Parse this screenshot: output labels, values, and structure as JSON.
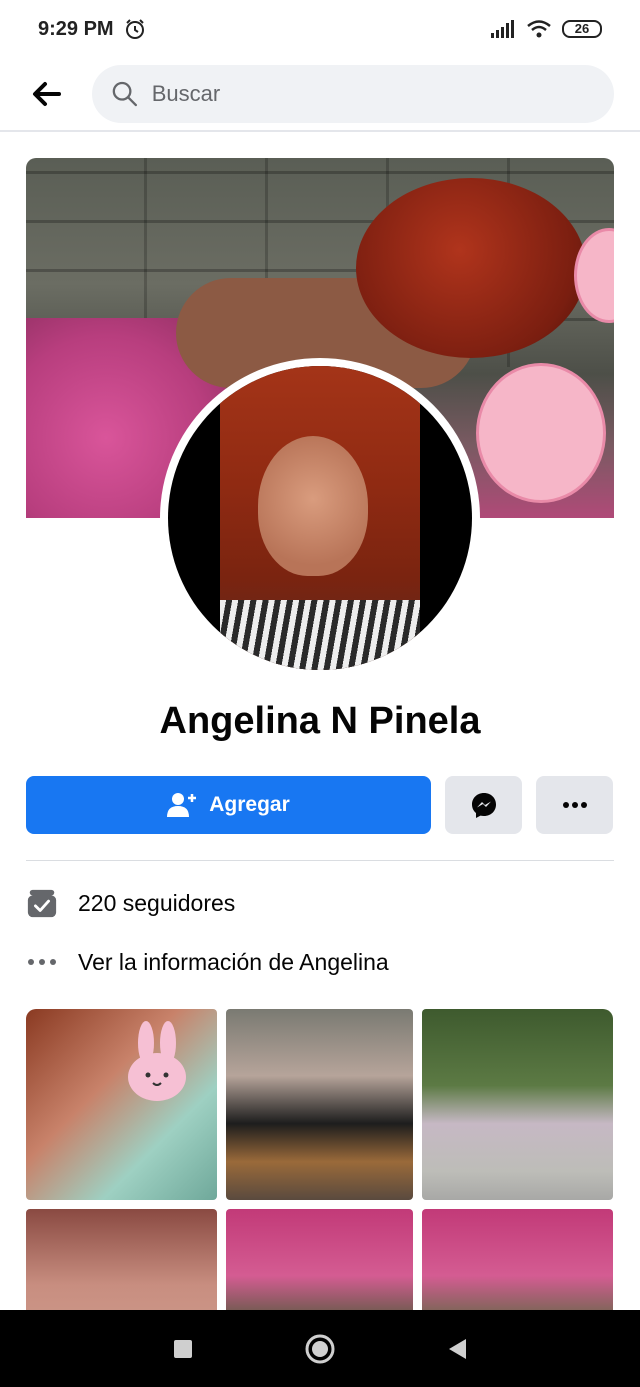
{
  "status_bar": {
    "time": "9:29 PM",
    "battery": "26",
    "icons": [
      "alarm-icon",
      "signal-icon",
      "wifi-icon",
      "battery-icon"
    ]
  },
  "search": {
    "placeholder": "Buscar"
  },
  "profile": {
    "name": "Angelina N Pinela"
  },
  "actions": {
    "add_label": "Agregar",
    "accent_color": "#1877f2"
  },
  "info": {
    "followers": "220 seguidores",
    "about": "Ver la información de Angelina"
  },
  "photos": {
    "count": 6
  },
  "colors": {
    "accent": "#1877f2",
    "button_gray": "#e4e6eb",
    "search_bg": "#f0f2f5"
  }
}
